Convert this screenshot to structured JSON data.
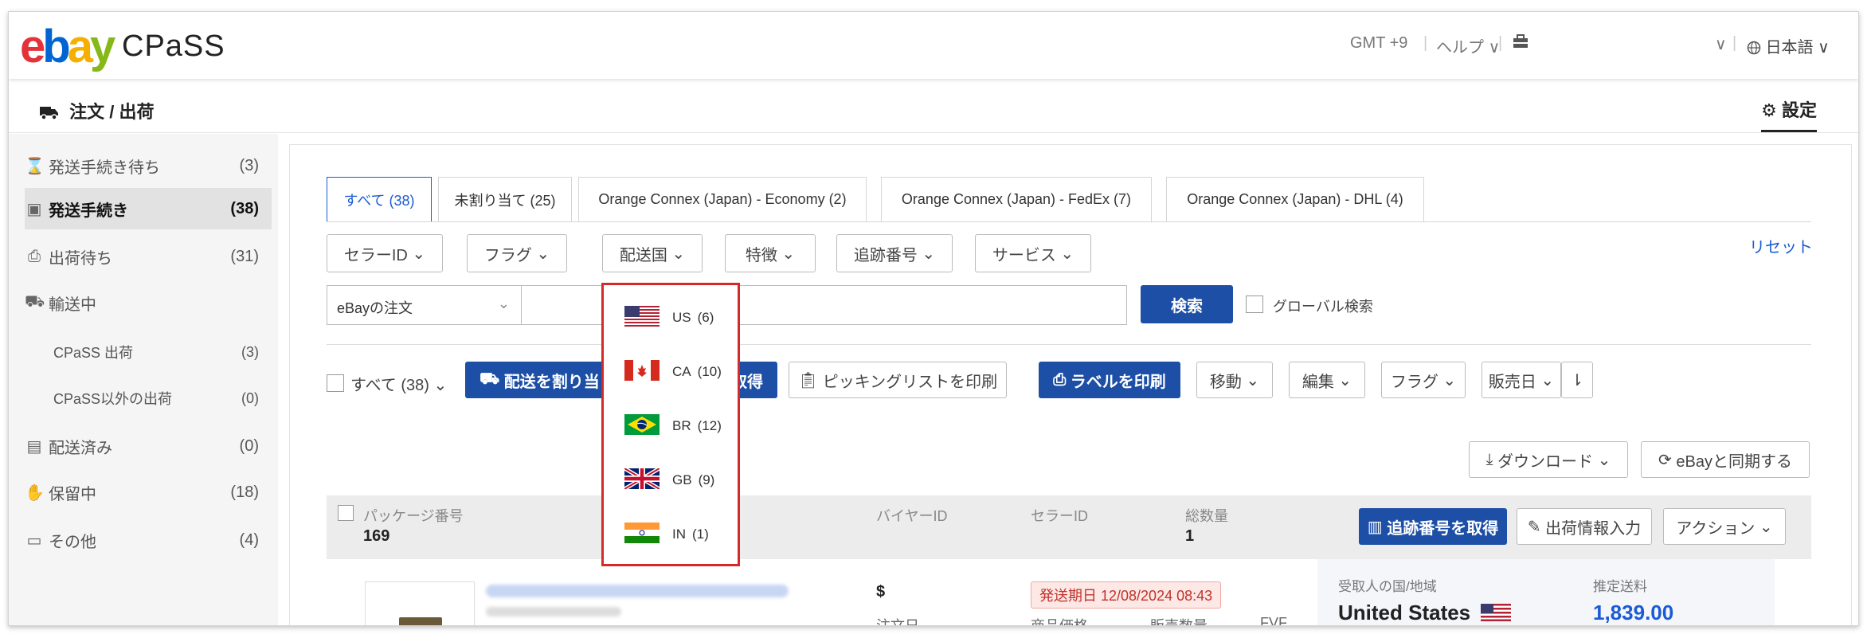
{
  "header": {
    "logo": {
      "e": "e",
      "b": "b",
      "a": "a",
      "y": "y"
    },
    "app_name": "CPaSS",
    "timezone": "GMT +9",
    "help": "ヘルプ",
    "language": "日本語"
  },
  "subheader": {
    "title": "注文 / 出荷",
    "settings": "設定"
  },
  "sidebar": {
    "items": [
      {
        "label": "発送手続き待ち",
        "count": "(3)",
        "icon": "hourglass-icon"
      },
      {
        "label": "発送手続き",
        "count": "(38)",
        "icon": "box-icon"
      },
      {
        "label": "出荷待ち",
        "count": "(31)",
        "icon": "printer-icon"
      },
      {
        "label": "輸送中",
        "count": "",
        "icon": "truck-icon"
      },
      {
        "label": "CPaSS 出荷",
        "count": "(3)",
        "icon": ""
      },
      {
        "label": "CPaSS以外の出荷",
        "count": "(0)",
        "icon": ""
      },
      {
        "label": "配送済み",
        "count": "(0)",
        "icon": "receipt-icon"
      },
      {
        "label": "保留中",
        "count": "(18)",
        "icon": "hand-icon"
      },
      {
        "label": "その他",
        "count": "(4)",
        "icon": "folder-icon"
      }
    ]
  },
  "tabs": [
    {
      "label": "すべて (38)"
    },
    {
      "label": "未割り当て (25)"
    },
    {
      "label": "Orange Connex (Japan) - Economy (2)"
    },
    {
      "label": "Orange Connex (Japan) - FedEx (7)"
    },
    {
      "label": "Orange Connex (Japan) - DHL (4)"
    }
  ],
  "filters": {
    "seller_id": "セラーID",
    "flag": "フラグ",
    "destination": "配送国",
    "feature": "特徴",
    "tracking": "追跡番号",
    "service": "サービス",
    "reset": "リセット"
  },
  "search": {
    "select_value": "eBayの注文",
    "button": "検索",
    "global_label": "グローバル検索"
  },
  "actions": {
    "select_all": "すべて (38)",
    "assign": "配送を割り当",
    "get_number": "号を取得",
    "picking": "ピッキングリストを印刷",
    "print_label": "ラベルを印刷",
    "move": "移動",
    "edit": "編集",
    "flag": "フラグ",
    "sale_date": "販売日",
    "download": "ダウンロード",
    "sync": "eBayと同期する"
  },
  "table": {
    "package_label": "パッケージ番号",
    "package_value": "169",
    "buyer_label": "バイヤーID",
    "seller_label": "セラーID",
    "total_label": "総数量",
    "total_value": "1",
    "get_tracking": "追跡番号を取得",
    "ship_info": "出荷情報入力",
    "action": "アクション"
  },
  "order": {
    "currency": "$",
    "order_date_label": "注文日",
    "deadline": "発送期日 12/08/2024 08:43",
    "price_label": "商品価格",
    "qty_label": "販売数量",
    "fvf_label": "FVF",
    "recipient_label": "受取人の国/地域",
    "country": "United States",
    "estimate_label": "推定送料",
    "estimate_value": "1,839.00"
  },
  "dropdown": {
    "items": [
      {
        "code": "US",
        "count": "(6)",
        "flag": "us-flag-icon"
      },
      {
        "code": "CA",
        "count": "(10)",
        "flag": "ca-flag-icon"
      },
      {
        "code": "BR",
        "count": "(12)",
        "flag": "br-flag-icon"
      },
      {
        "code": "GB",
        "count": "(9)",
        "flag": "gb-flag-icon"
      },
      {
        "code": "IN",
        "count": "(1)",
        "flag": "in-flag-icon"
      }
    ]
  },
  "colors": {
    "accent": "#1c4fa5",
    "link": "#1a5bd5",
    "highlight_border": "#d42a2a",
    "deadline_bg": "#fde8e6"
  }
}
